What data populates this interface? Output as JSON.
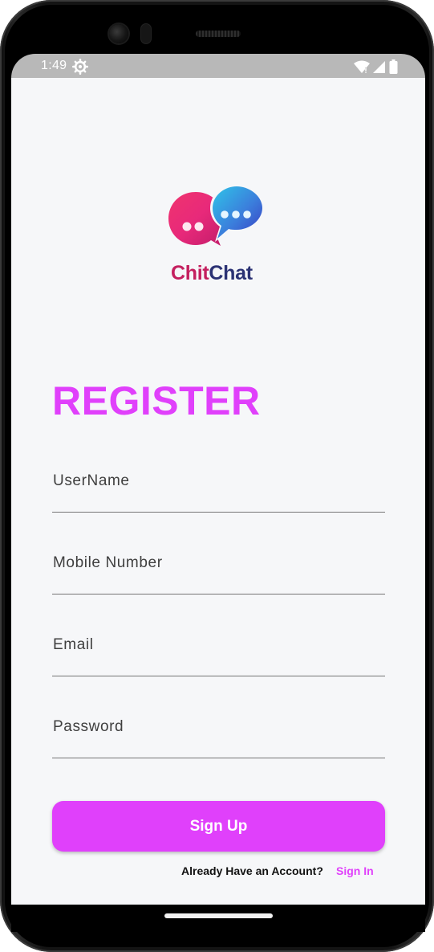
{
  "status_bar": {
    "time": "1:49",
    "icons": [
      "settings-icon",
      "wifi-icon",
      "signal-icon",
      "battery-icon"
    ]
  },
  "logo": {
    "text_part1": "Chit",
    "text_part2": "Chat"
  },
  "form": {
    "title": "REGISTER",
    "fields": [
      {
        "label": "UserName",
        "value": ""
      },
      {
        "label": "Mobile Number",
        "value": ""
      },
      {
        "label": "Email",
        "value": ""
      },
      {
        "label": "Password",
        "value": ""
      }
    ],
    "submit_label": "Sign Up",
    "footer_prompt": "Already Have an Account?",
    "footer_link": "Sign In"
  },
  "colors": {
    "accent": "#e040fb",
    "logo_chit": "#c4205f",
    "logo_chat": "#2b3274",
    "screen_bg": "#f6f7f9"
  }
}
